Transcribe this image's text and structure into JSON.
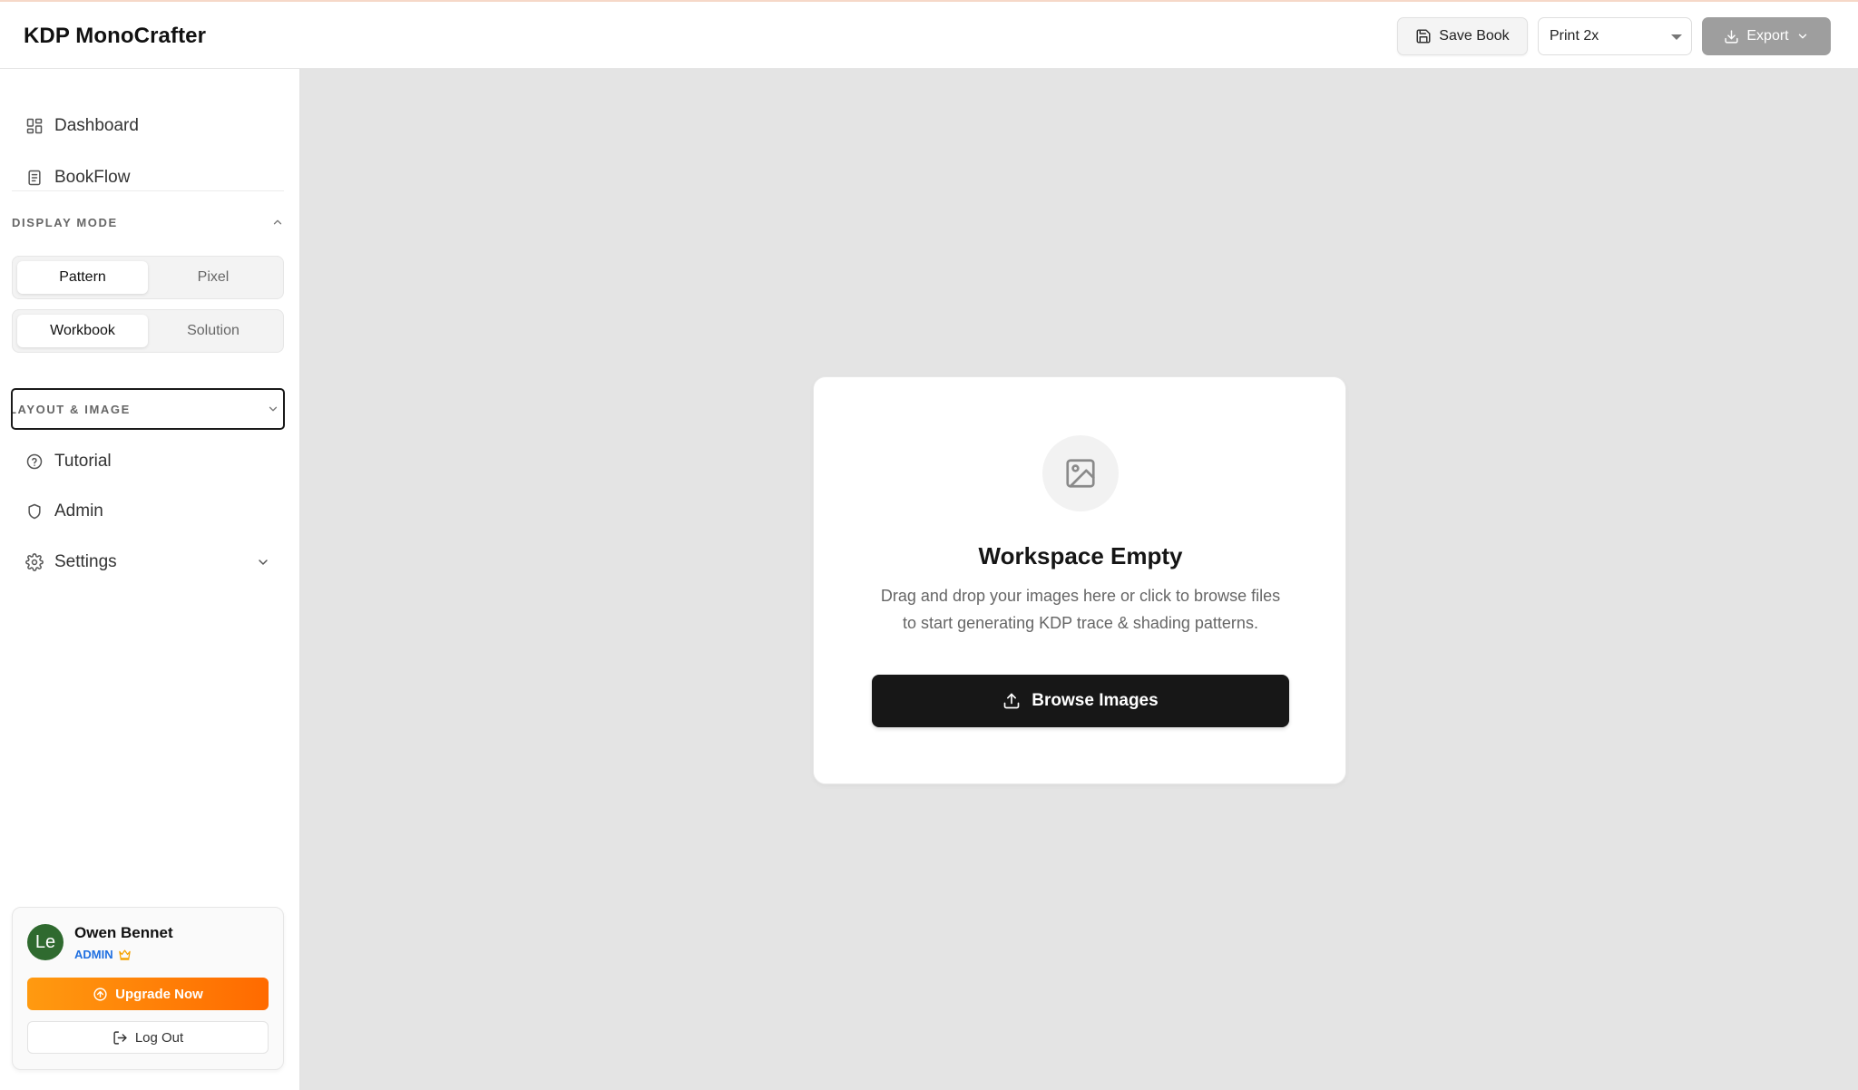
{
  "header": {
    "app_title": "KDP MonoCrafter",
    "save_label": "Save Book",
    "print_select_value": "Print 2x",
    "export_label": "Export"
  },
  "sidebar": {
    "nav_top": [
      {
        "label": "Dashboard",
        "icon": "dashboard-icon"
      },
      {
        "label": "BookFlow",
        "icon": "book-icon"
      }
    ],
    "display_mode": {
      "title": "DISPLAY MODE",
      "expanded": true,
      "view_toggle": {
        "options": [
          "Pattern",
          "Pixel"
        ],
        "selected": "Pattern"
      },
      "output_toggle": {
        "options": [
          "Workbook",
          "Solution"
        ],
        "selected": "Workbook"
      }
    },
    "layout_section": {
      "title": "LAYOUT & IMAGE",
      "expanded": false
    },
    "nav_bottom": [
      {
        "label": "Tutorial",
        "icon": "help-circle-icon"
      },
      {
        "label": "Admin",
        "icon": "shield-icon"
      },
      {
        "label": "Settings",
        "icon": "gear-icon"
      }
    ],
    "user": {
      "initials": "Le",
      "name": "Owen Bennet",
      "role": "ADMIN",
      "upgrade_label": "Upgrade Now",
      "logout_label": "Log Out"
    }
  },
  "main": {
    "empty_state": {
      "title": "Workspace Empty",
      "description_line1": "Drag and drop your images here or click to browse files",
      "description_line2": "to start generating KDP trace & shading patterns.",
      "button_label": "Browse Images"
    }
  },
  "colors": {
    "accent_orange": "#ff7a00",
    "role_blue": "#1f6fe0",
    "avatar_green": "#2f6a2f",
    "primary_dark": "#171717"
  }
}
